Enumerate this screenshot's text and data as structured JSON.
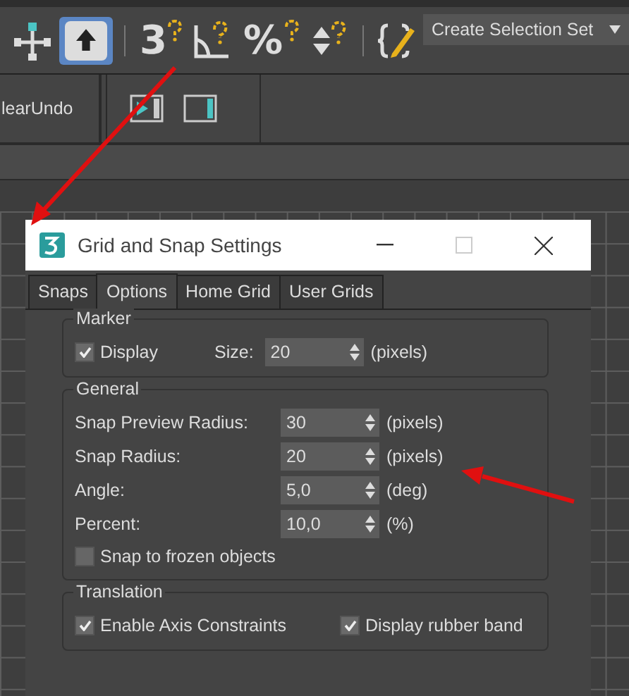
{
  "toolbar": {
    "items": [
      {
        "kind": "move",
        "selected": false
      },
      {
        "kind": "select",
        "selected": true
      },
      {
        "kind": "glyph",
        "glyph": "3",
        "selected": false
      },
      {
        "kind": "angle",
        "selected": false
      },
      {
        "kind": "glyph",
        "glyph": "%",
        "selected": false
      },
      {
        "kind": "spinner",
        "selected": false
      },
      {
        "kind": "braces",
        "selected": false
      }
    ],
    "dropdown": "Create Selection Set"
  },
  "toolbar_2": {
    "command": "learUndo"
  },
  "dialog": {
    "title": "Grid and Snap Settings",
    "tabs": [
      {
        "label": "Snaps",
        "selected": false
      },
      {
        "label": "Options",
        "selected": true
      },
      {
        "label": "Home Grid",
        "selected": false
      },
      {
        "label": "User Grids",
        "selected": false
      }
    ],
    "marker": {
      "title": "Marker",
      "display": {
        "label": "Display",
        "checked": true
      },
      "size": {
        "label": "Size:",
        "value": "20",
        "unit": "(pixels)"
      }
    },
    "general": {
      "title": "General",
      "fields": [
        {
          "label": "Snap Preview Radius:",
          "value": "30",
          "unit": "(pixels)"
        },
        {
          "label": "Snap Radius:",
          "value": "20",
          "unit": "(pixels)"
        },
        {
          "label": "Angle:",
          "value": "5,0",
          "unit": "(deg)"
        },
        {
          "label": "Percent:",
          "value": "10,0",
          "unit": "(%)"
        }
      ],
      "frozen": {
        "label": "Snap to frozen objects",
        "checked": false
      }
    },
    "translation": {
      "title": "Translation",
      "options": [
        {
          "label": "Enable Axis Constraints",
          "checked": true
        },
        {
          "label": "Display rubber band",
          "checked": true
        }
      ]
    }
  }
}
